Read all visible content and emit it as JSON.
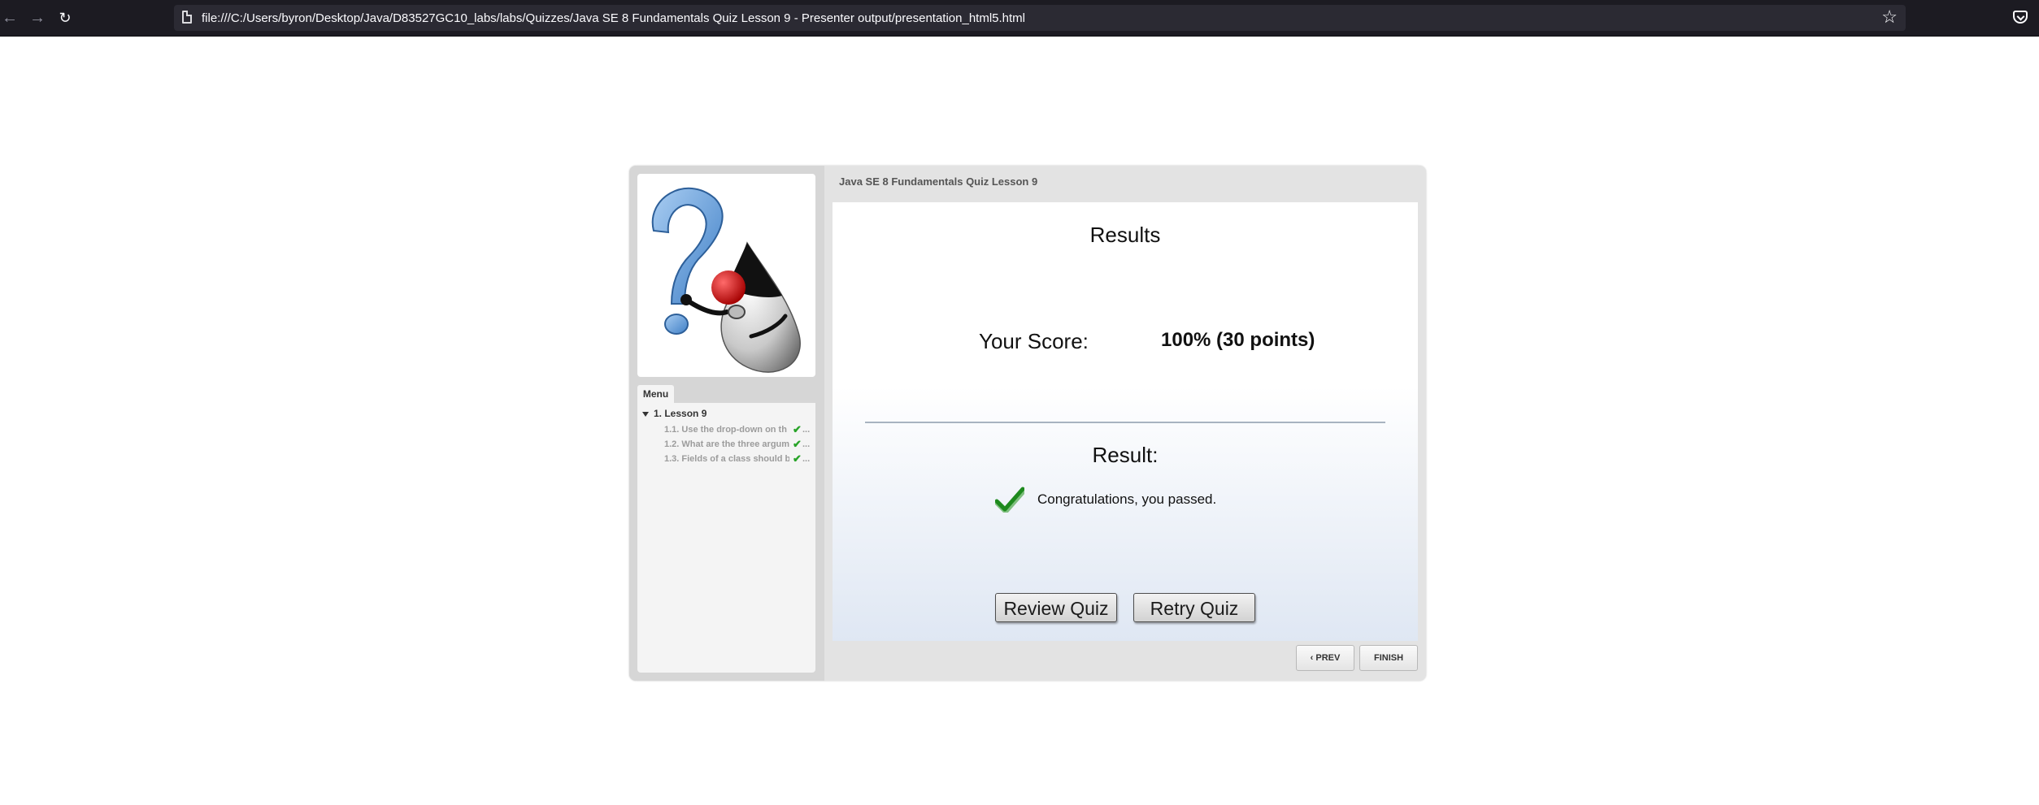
{
  "browser": {
    "url": "file:///C:/Users/byron/Desktop/Java/D83527GC10_labs/labs/Quizzes/Java SE 8 Fundamentals Quiz Lesson 9 - Presenter output/presentation_html5.html",
    "icons": [
      "back-arrow-icon",
      "forward-arrow-icon",
      "reload-icon",
      "page-icon",
      "bookmark-star-icon",
      "pocket-icon"
    ]
  },
  "sidebar": {
    "menu_tab": "Menu",
    "lesson": "1. Lesson 9",
    "items": [
      {
        "label": "1.1. Use the drop-down on th",
        "completed": true
      },
      {
        "label": "1.2. What are the three argum",
        "completed": true
      },
      {
        "label": "1.3. Fields of a class should b",
        "completed": true
      }
    ],
    "ellipsis": "..."
  },
  "main": {
    "title": "Java SE 8 Fundamentals Quiz Lesson 9",
    "results_title": "Results",
    "score_label": "Your Score:",
    "score_value": "100% (30 points)",
    "result_label": "Result:",
    "result_message": "Congratulations, you passed.",
    "review_button": "Review Quiz",
    "retry_button": "Retry Quiz"
  },
  "footer": {
    "prev_label": "PREV",
    "finish_label": "FINISH"
  },
  "colors": {
    "check_green": "#1e8a1e",
    "chrome_bg": "#1c1b22"
  }
}
